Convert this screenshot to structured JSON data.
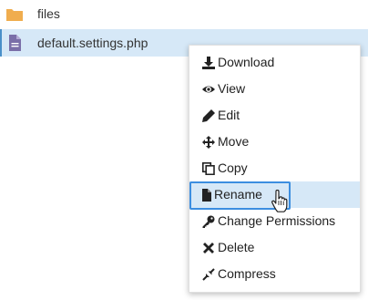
{
  "files": [
    {
      "name": "files",
      "type": "folder",
      "icon": "folder-icon"
    },
    {
      "name": "default.settings.php",
      "type": "file",
      "icon": "file-icon",
      "selected": true
    }
  ],
  "context_menu": {
    "items": [
      {
        "label": "Download",
        "icon": "download-icon"
      },
      {
        "label": "View",
        "icon": "eye-icon"
      },
      {
        "label": "Edit",
        "icon": "pencil-icon"
      },
      {
        "label": "Move",
        "icon": "move-arrows-icon"
      },
      {
        "label": "Copy",
        "icon": "copy-icon"
      },
      {
        "label": "Rename",
        "icon": "file-icon",
        "hovered": true
      },
      {
        "label": "Change Permissions",
        "icon": "key-icon"
      },
      {
        "label": "Delete",
        "icon": "x-icon"
      },
      {
        "label": "Compress",
        "icon": "compress-icon"
      }
    ]
  },
  "colors": {
    "folder": "#f0ad4e",
    "file": "#7a6ea8",
    "selection": "#d6e8f7",
    "hover_border": "#3c8ee0"
  }
}
